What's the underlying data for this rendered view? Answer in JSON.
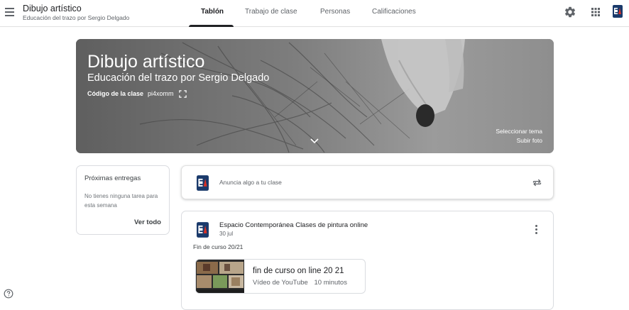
{
  "header": {
    "title": "Dibujo artístico",
    "subtitle": "Educación del trazo por Sergio Delgado",
    "tabs": [
      {
        "label": "Tablón",
        "active": true
      },
      {
        "label": "Trabajo de clase",
        "active": false
      },
      {
        "label": "Personas",
        "active": false
      },
      {
        "label": "Calificaciones",
        "active": false
      }
    ],
    "icons": [
      "menu-icon",
      "gear-icon",
      "apps-grid-icon",
      "account-avatar"
    ]
  },
  "banner": {
    "title": "Dibujo artístico",
    "subtitle": "Educación del trazo por Sergio Delgado",
    "code_label": "Código de la clase",
    "code_value": "pi4xomm",
    "select_theme": "Seleccionar tema",
    "upload_photo": "Subir foto"
  },
  "upcoming": {
    "title": "Próximas entregas",
    "text": "No tienes ninguna tarea para esta semana",
    "link": "Ver todo"
  },
  "announce": {
    "placeholder": "Anuncia algo a tu clase"
  },
  "post": {
    "author": "Espacio Contemporánea Clases de pintura online",
    "date": "30 jul",
    "text": "Fin de curso 20/21",
    "attachment": {
      "title": "fin de curso on line 20 21",
      "source": "Vídeo de YouTube",
      "duration": "10 minutos"
    }
  },
  "colors": {
    "accent": "#202124",
    "avatar_blue": "#1a3a6b",
    "avatar_red": "#d93025"
  }
}
